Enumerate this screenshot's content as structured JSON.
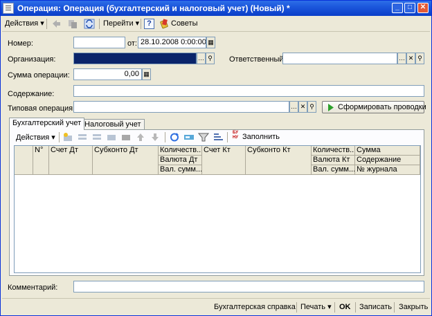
{
  "window": {
    "title": "Операция: Операция (бухгалтерский и налоговый учет) (Новый) *"
  },
  "toolbar": {
    "actions_label": "Действия",
    "goto_label": "Перейти",
    "help_label": "?",
    "tips_label": "Советы"
  },
  "form": {
    "number_label": "Номер:",
    "number_value": "",
    "from_label": "от:",
    "date_value": "28.10.2008  0:00:00",
    "org_label": "Организация:",
    "responsible_label": "Ответственный:",
    "amount_label": "Сумма операции:",
    "amount_value": "0,00",
    "content_label": "Содержание:",
    "typical_op_label": "Типовая операция:",
    "generate_button": "Сформировать проводки",
    "comment_label": "Комментарий:"
  },
  "tabs": [
    {
      "label": "Бухгалтерский учет"
    },
    {
      "label": "Налоговый учет"
    }
  ],
  "grid_toolbar": {
    "actions_label": "Действия",
    "fill_label": "Заполнить",
    "fill_icon_text": "БУ НУ"
  },
  "grid": {
    "headers": {
      "n": "N°",
      "debit_account": "Счет Дт",
      "debit_subconto": "Субконто Дт",
      "debit_qty": "Количеств...",
      "debit_currency": "Валюта Дт",
      "debit_cur_sum": "Вал. сумм...",
      "credit_account": "Счет Кт",
      "credit_subconto": "Субконто Кт",
      "credit_qty": "Количеств...",
      "credit_currency": "Валюта Кт",
      "credit_cur_sum": "Вал. сумм...",
      "sum": "Сумма",
      "content": "Содержание",
      "journal": "№ журнала"
    }
  },
  "footer": {
    "report_button": "Бухгалтерская справка",
    "print_button": "Печать",
    "ok_button": "OK",
    "save_button": "Записать",
    "close_button": "Закрыть"
  },
  "colors": {
    "title_bar": "#0a3ec8",
    "selection": "#0a246a",
    "generate_icon": "#2ca02c"
  }
}
